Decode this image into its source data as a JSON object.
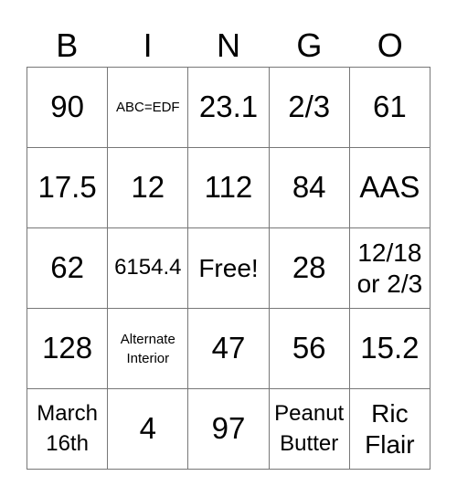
{
  "header": [
    "B",
    "I",
    "N",
    "G",
    "O"
  ],
  "cells": [
    [
      "90",
      "ABC=EDF",
      "23.1",
      "2/3",
      "61"
    ],
    [
      "17.5",
      "12",
      "112",
      "84",
      "AAS"
    ],
    [
      "62",
      "6154.4",
      "Free!",
      "28",
      "12/18\nor 2/3"
    ],
    [
      "128",
      "Alternate\nInterior",
      "47",
      "56",
      "15.2"
    ],
    [
      "March\n16th",
      "4",
      "97",
      "Peanut\nButter",
      "Ric\nFlair"
    ]
  ],
  "styles": [
    [
      "",
      "s",
      "",
      "",
      ""
    ],
    [
      "",
      "",
      "",
      "",
      ""
    ],
    [
      "",
      "m",
      "l",
      "",
      "l"
    ],
    [
      "",
      "s",
      "",
      "",
      ""
    ],
    [
      "m",
      "",
      "",
      "m",
      "l"
    ]
  ]
}
